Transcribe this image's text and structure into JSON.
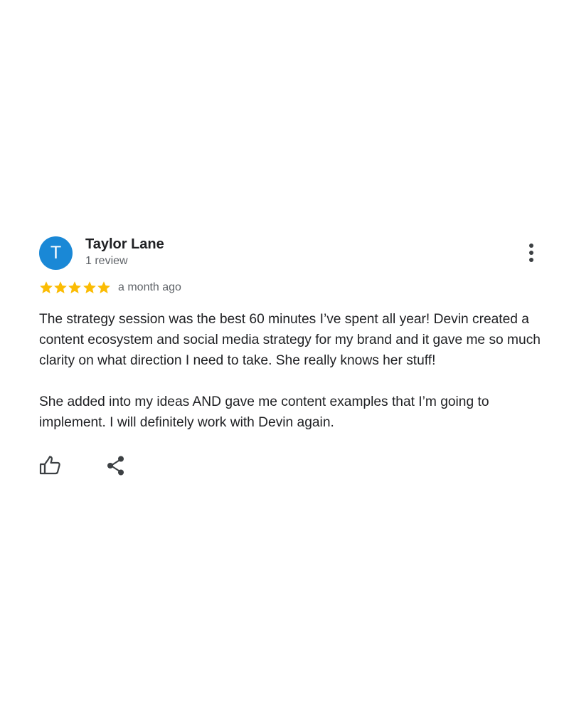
{
  "review": {
    "avatar_letter": "T",
    "reviewer_name": "Taylor Lane",
    "review_count": "1 review",
    "rating": 5,
    "rating_max": 5,
    "time_ago": "a month ago",
    "paragraphs": [
      "The strategy session was the best 60 minutes I’ve spent all year! Devin created a content ecosystem and social media strategy for my brand and it gave me so much clarity on what direction I need to take. She really knows her stuff!",
      "She added into my ideas AND gave me content examples that I’m going to implement. I will definitely work with Devin again."
    ]
  },
  "icons": {
    "more": "more-vert-icon",
    "like": "thumbs-up-icon",
    "share": "share-icon"
  },
  "colors": {
    "avatar_bg": "#1a88d6",
    "star": "#fbbc04",
    "text": "#202124",
    "secondary_text": "#5f6368"
  }
}
